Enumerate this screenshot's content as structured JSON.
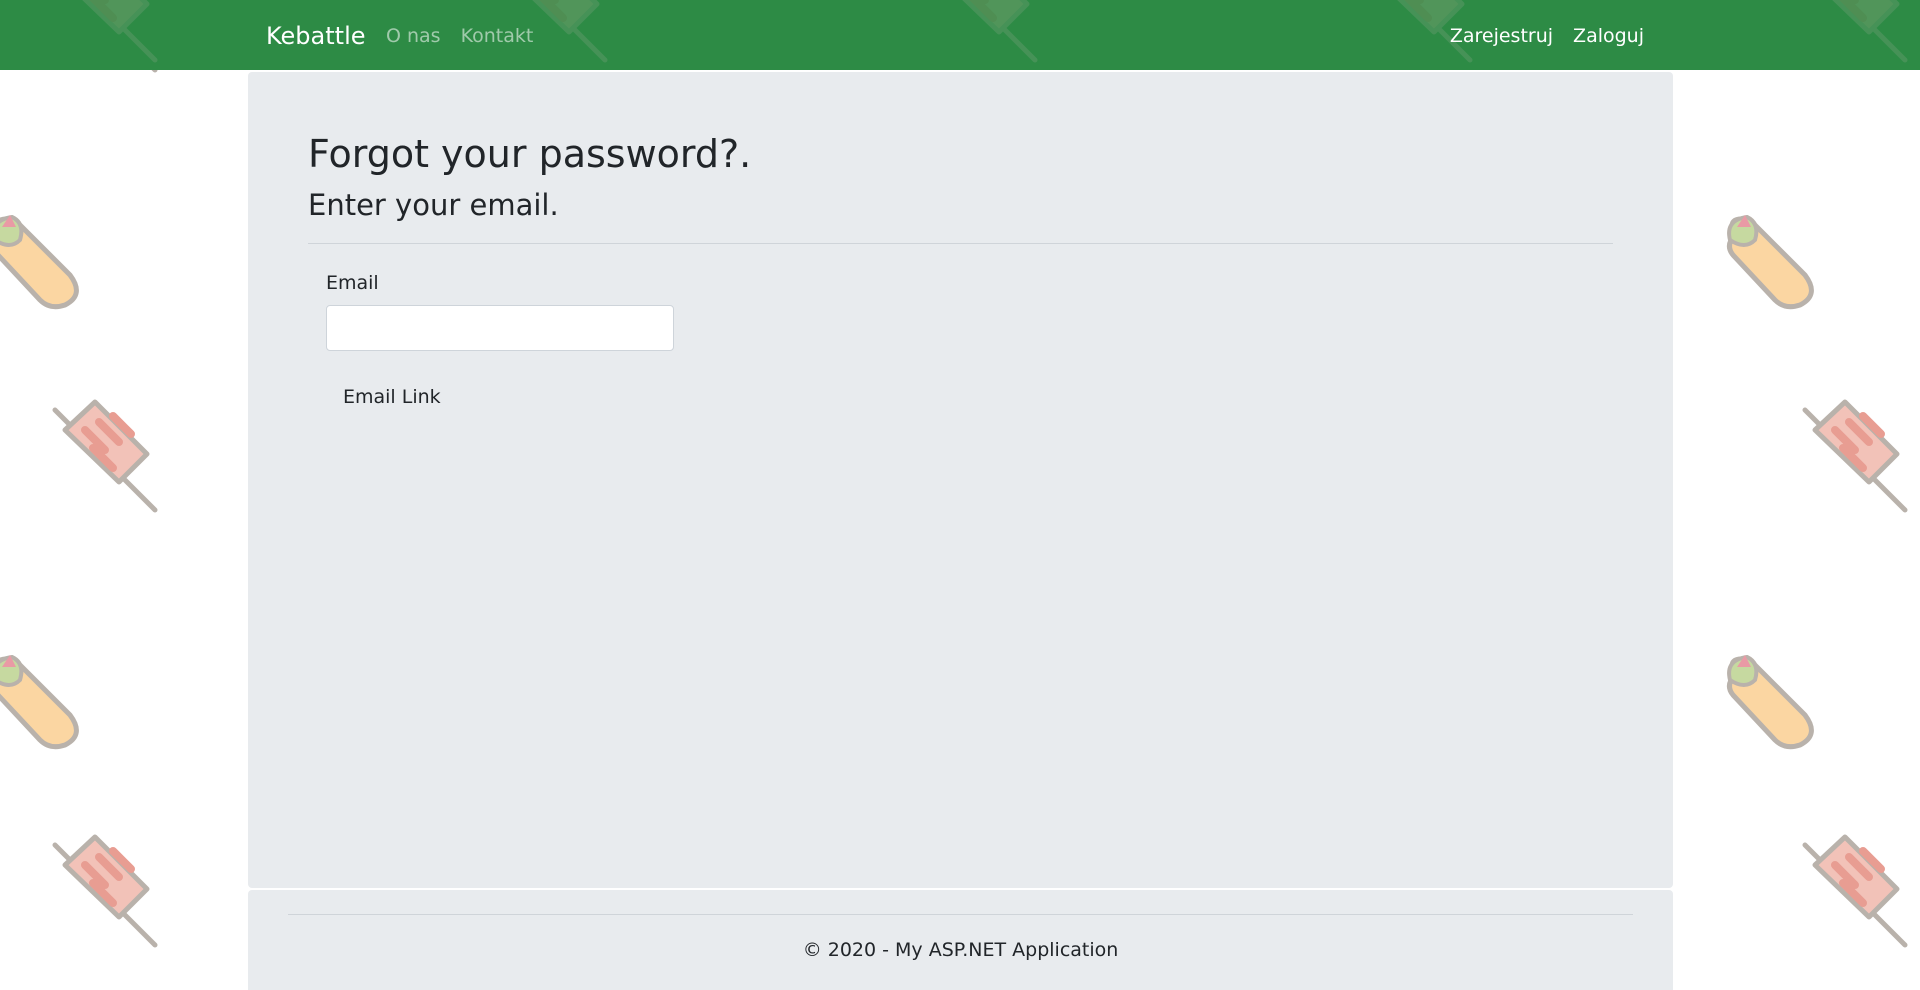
{
  "navbar": {
    "brand": "Kebattle",
    "left_links": [
      "O nas",
      "Kontakt"
    ],
    "right_links": [
      "Zarejestruj",
      "Zaloguj"
    ],
    "color": "#2d8b45"
  },
  "page": {
    "title": "Forgot your password?.",
    "subtitle": "Enter your email.",
    "email_label": "Email",
    "email_value": "",
    "email_placeholder": "",
    "submit_label": "Email Link"
  },
  "footer": {
    "text": "© 2020 - My ASP.NET Application"
  },
  "background": {
    "pattern": [
      "kebab-skewer-icon",
      "wrap-burrito-icon"
    ]
  }
}
